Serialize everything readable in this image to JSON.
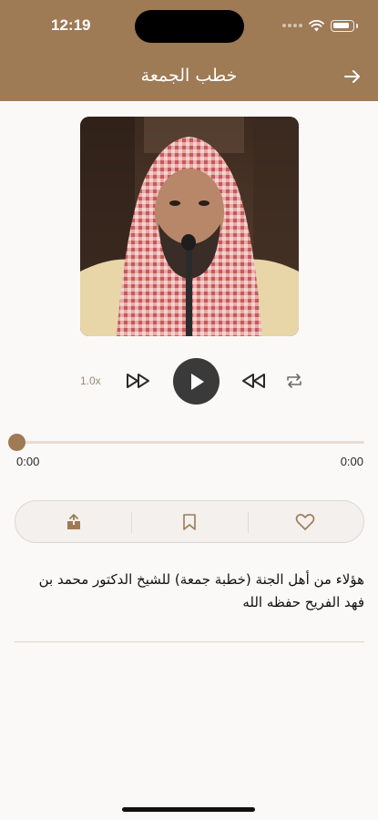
{
  "status_bar": {
    "time": "12:19"
  },
  "header": {
    "title": "خطب الجمعة",
    "back_icon": "arrow-right-icon"
  },
  "player": {
    "speed_label": "1.0x",
    "current_time": "0:00",
    "total_time": "0:00",
    "progress": 0,
    "icons": [
      "fast-forward-icon",
      "play-icon",
      "rewind-icon",
      "repeat-icon"
    ]
  },
  "actions": {
    "icons": [
      "share-icon",
      "bookmark-icon",
      "heart-icon"
    ]
  },
  "description": {
    "text": "هؤلاء من أهل الجنة (خطبة جمعة) للشيخ الدكتور محمد بن فهد الفريح حفظه الله"
  },
  "colors": {
    "accent": "#9e7a55",
    "background": "#fbf9f7",
    "play_button": "#3a3a3a"
  }
}
